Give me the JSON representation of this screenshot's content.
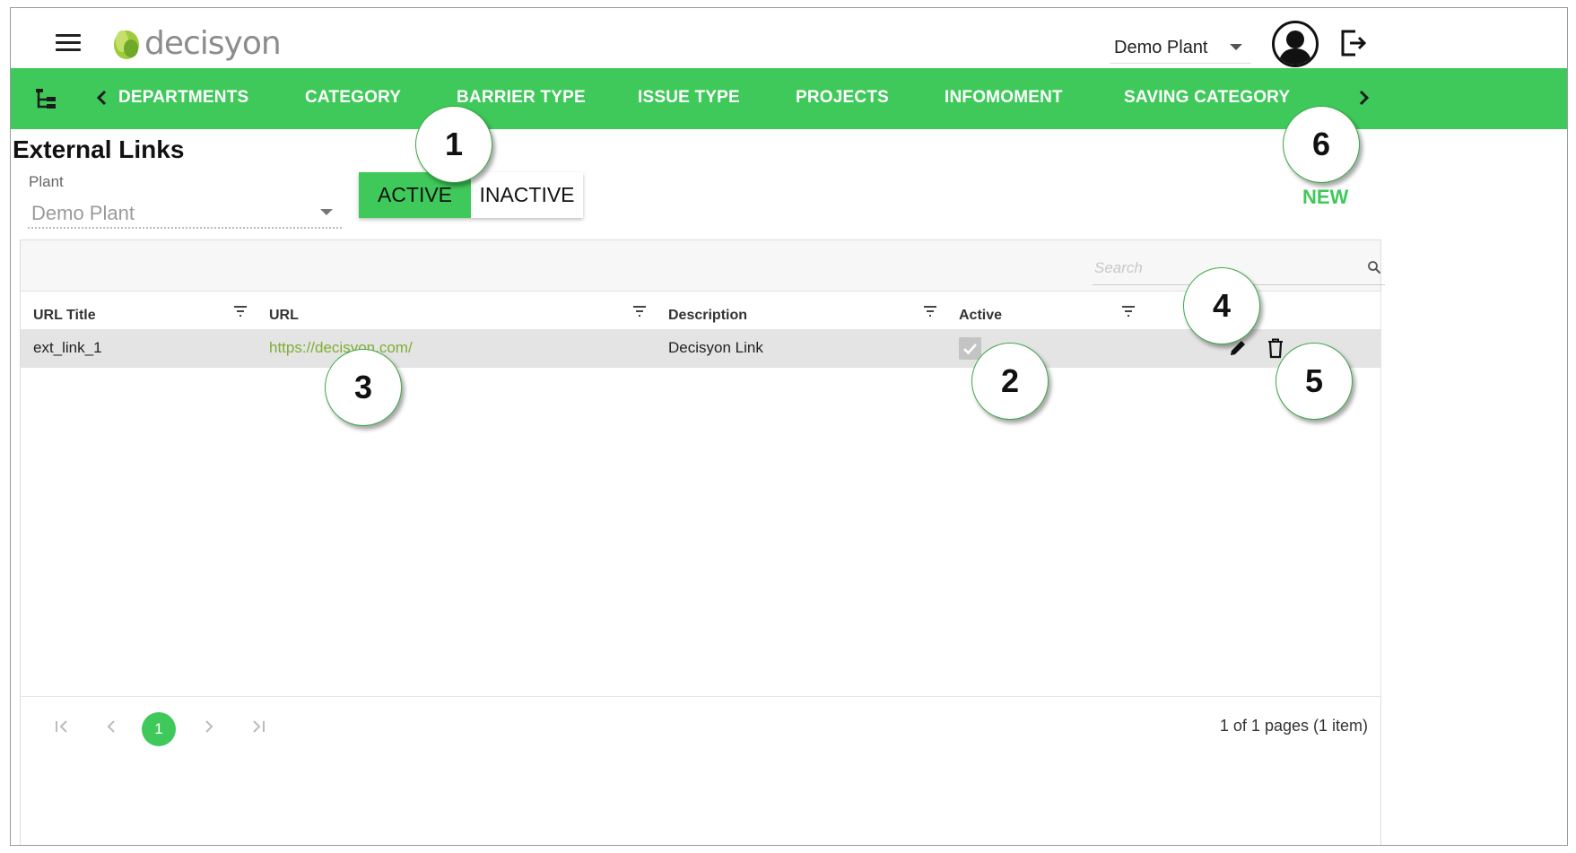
{
  "header": {
    "logo_text": "decisyon",
    "plant_selector_value": "Demo Plant"
  },
  "nav": {
    "tabs": [
      {
        "label": "DEPARTMENTS"
      },
      {
        "label": "CATEGORY"
      },
      {
        "label": "BARRIER TYPE"
      },
      {
        "label": "ISSUE TYPE"
      },
      {
        "label": "PROJECTS"
      },
      {
        "label": "INFOMOMENT"
      },
      {
        "label": "SAVING CATEGORY"
      }
    ]
  },
  "page": {
    "title": "External Links",
    "plant_label": "Plant",
    "plant_value": "Demo Plant",
    "toggle": {
      "active_label": "ACTIVE",
      "inactive_label": "INACTIVE",
      "selected": "ACTIVE"
    },
    "new_label": "NEW"
  },
  "grid": {
    "search_placeholder": "Search",
    "columns": [
      {
        "label": "URL Title"
      },
      {
        "label": "URL"
      },
      {
        "label": "Description"
      },
      {
        "label": "Active"
      }
    ],
    "rows": [
      {
        "title": "ext_link_1",
        "url": "https://decisyon.com/",
        "description": "Decisyon Link",
        "active": true
      }
    ],
    "pager": {
      "current_page": "1",
      "info": "1 of 1 pages (1 item)"
    }
  },
  "callouts": [
    "1",
    "2",
    "3",
    "4",
    "5",
    "6"
  ],
  "colors": {
    "accent": "#3fc95a",
    "link": "#7fae32"
  }
}
